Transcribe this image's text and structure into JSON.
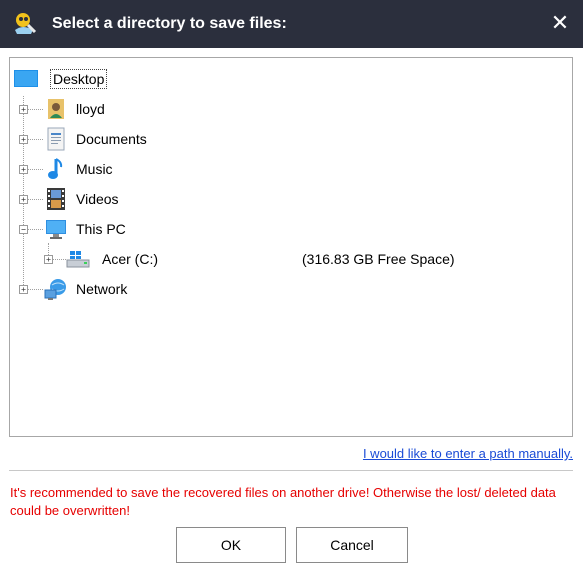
{
  "dialog": {
    "title": "Select a directory to save files:",
    "close_glyph": "✕"
  },
  "tree": {
    "nodes": [
      {
        "label": "Desktop",
        "icon": "desktop-icon",
        "selected": true
      },
      {
        "label": "lloyd",
        "icon": "user-icon",
        "expander": "+"
      },
      {
        "label": "Documents",
        "icon": "documents-icon",
        "expander": "+"
      },
      {
        "label": "Music",
        "icon": "music-icon",
        "expander": "+"
      },
      {
        "label": "Videos",
        "icon": "videos-icon",
        "expander": "+"
      },
      {
        "label": "This PC",
        "icon": "computer-icon",
        "expander": "−"
      },
      {
        "label": "Acer (C:)",
        "icon": "drive-icon",
        "expander": "+",
        "free_space": "(316.83 GB Free Space)"
      },
      {
        "label": "Network",
        "icon": "network-icon",
        "expander": "+"
      }
    ]
  },
  "manual_path_link": "I would like to enter a path manually.",
  "warning": "It's recommended to save the recovered files on another drive! Otherwise the lost/ deleted data could be overwritten!",
  "buttons": {
    "ok": "OK",
    "cancel": "Cancel"
  },
  "colors": {
    "titlebar": "#2b2f3d",
    "warning": "#e60000",
    "link": "#1a4bd6"
  }
}
